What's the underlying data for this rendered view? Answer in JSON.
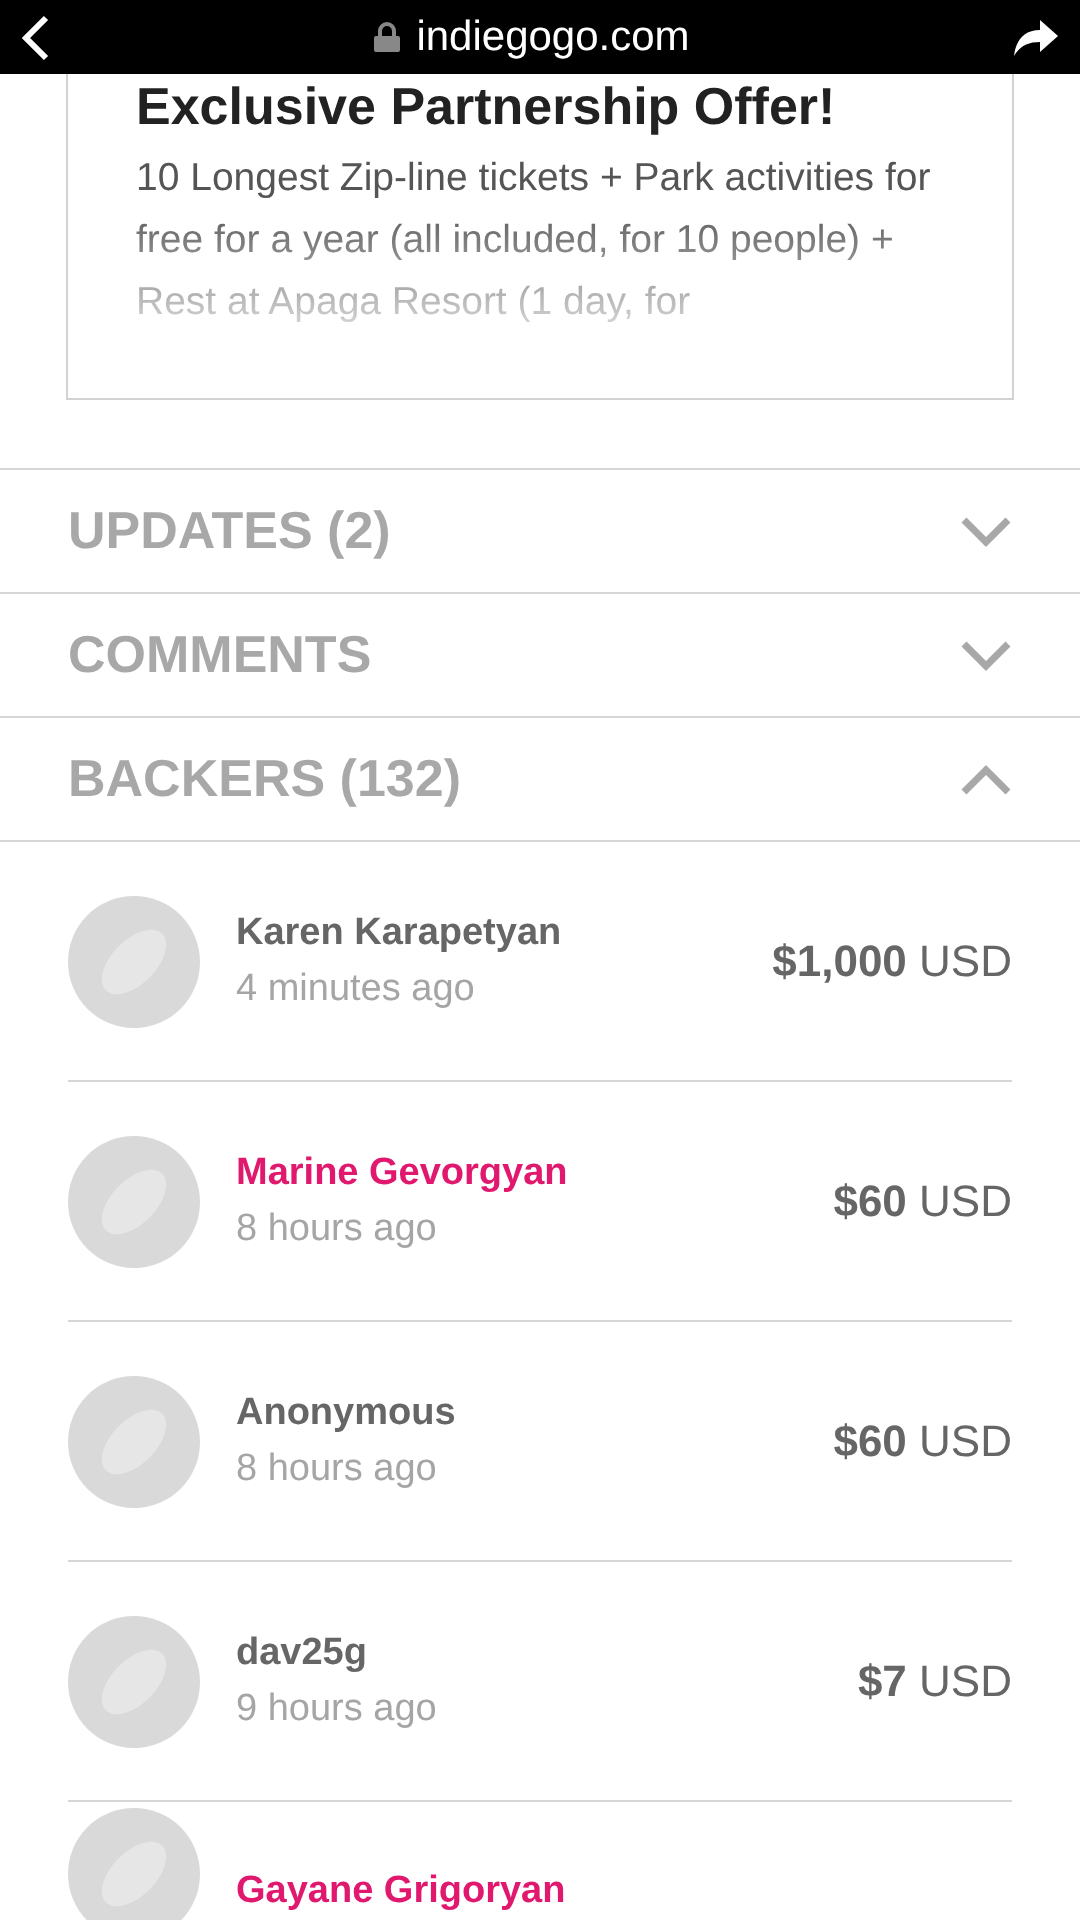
{
  "browser_bar": {
    "domain": "indiegogo.com"
  },
  "perk": {
    "title": "Exclusive Partnership Offer!",
    "description": "10 Longest Zip-line tickets + Park activities for free for a year (all included, for 10 people) + Rest at Apaga Resort (1 day, for"
  },
  "sections": [
    {
      "label": "UPDATES (2)",
      "expanded": false
    },
    {
      "label": "COMMENTS",
      "expanded": false
    },
    {
      "label": "BACKERS (132)",
      "expanded": true
    }
  ],
  "backers": [
    {
      "name": "Karen Karapetyan",
      "linked": false,
      "time": "4 minutes ago",
      "amount": "$1,000",
      "currency": "USD"
    },
    {
      "name": "Marine Gevorgyan",
      "linked": true,
      "time": "8 hours ago",
      "amount": "$60",
      "currency": "USD"
    },
    {
      "name": "Anonymous",
      "linked": false,
      "time": "8 hours ago",
      "amount": "$60",
      "currency": "USD"
    },
    {
      "name": "dav25g",
      "linked": false,
      "time": "9 hours ago",
      "amount": "$7",
      "currency": "USD"
    },
    {
      "name": "Gayane Grigoryan",
      "linked": true
    }
  ]
}
